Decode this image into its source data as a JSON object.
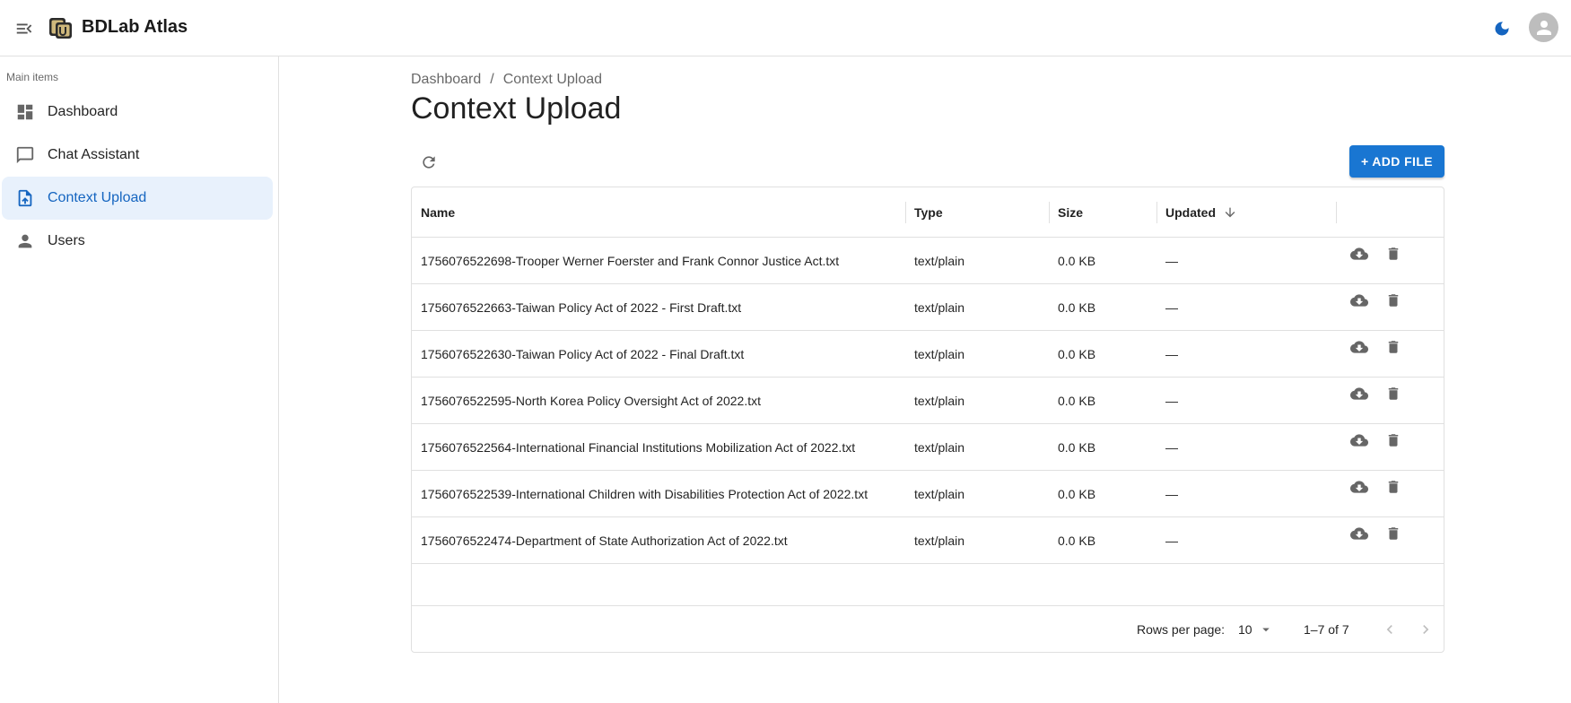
{
  "app": {
    "title": "BDLab Atlas"
  },
  "sidebar": {
    "header": "Main items",
    "items": [
      {
        "label": "Dashboard",
        "icon": "dashboard-icon"
      },
      {
        "label": "Chat Assistant",
        "icon": "chat-icon"
      },
      {
        "label": "Context Upload",
        "icon": "upload-file-icon",
        "active": true
      },
      {
        "label": "Users",
        "icon": "person-icon"
      }
    ]
  },
  "breadcrumb": {
    "root": "Dashboard",
    "separator": "/",
    "current": "Context Upload"
  },
  "page": {
    "title": "Context Upload"
  },
  "toolbar": {
    "add_label": "+ ADD FILE"
  },
  "table": {
    "columns": {
      "name": "Name",
      "type": "Type",
      "size": "Size",
      "updated": "Updated"
    },
    "sort": {
      "column": "updated",
      "direction": "desc"
    },
    "rows": [
      {
        "name": "1756076522698-Trooper Werner Foerster and Frank Connor Justice Act.txt",
        "type": "text/plain",
        "size": "0.0 KB",
        "updated": "—"
      },
      {
        "name": "1756076522663-Taiwan Policy Act of 2022 - First Draft.txt",
        "type": "text/plain",
        "size": "0.0 KB",
        "updated": "—"
      },
      {
        "name": "1756076522630-Taiwan Policy Act of 2022 - Final Draft.txt",
        "type": "text/plain",
        "size": "0.0 KB",
        "updated": "—"
      },
      {
        "name": "1756076522595-North Korea Policy Oversight Act of 2022.txt",
        "type": "text/plain",
        "size": "0.0 KB",
        "updated": "—"
      },
      {
        "name": "1756076522564-International Financial Institutions Mobilization Act of 2022.txt",
        "type": "text/plain",
        "size": "0.0 KB",
        "updated": "—"
      },
      {
        "name": "1756076522539-International Children with Disabilities Protection Act of 2022.txt",
        "type": "text/plain",
        "size": "0.0 KB",
        "updated": "—"
      },
      {
        "name": "1756076522474-Department of State Authorization Act of 2022.txt",
        "type": "text/plain",
        "size": "0.0 KB",
        "updated": "—"
      }
    ]
  },
  "pagination": {
    "rows_per_page_label": "Rows per page:",
    "rows_per_page": "10",
    "range": "1–7 of 7"
  },
  "colors": {
    "accent": "#1976d2",
    "active_bg": "#e8f1fc",
    "active_text": "#1565c0"
  }
}
